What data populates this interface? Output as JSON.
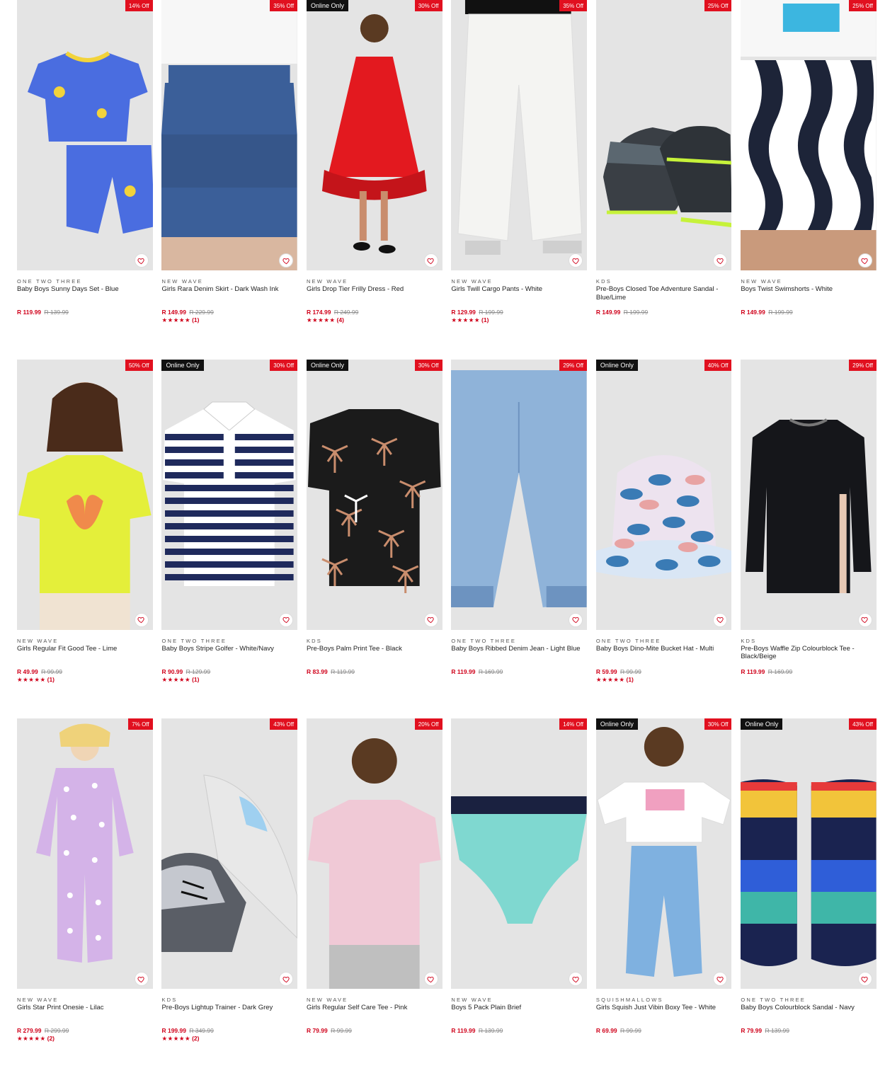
{
  "colors": {
    "sale_red": "#e1101f",
    "price_red": "#d0021b",
    "online_black": "#111111",
    "image_bg": "#e4e4e4"
  },
  "products": [
    {
      "brand": "ONE TWO THREE",
      "title": "Baby Boys Sunny Days Set - Blue",
      "price": "R 119.99",
      "was": "R 139.99",
      "discount": "14% Off",
      "online": "",
      "stars": "",
      "reviews": "",
      "art": "pajama",
      "colors": [
        "#4a6de0",
        "#f2d33b"
      ]
    },
    {
      "brand": "NEW WAVE",
      "title": "Girls Rara Denim Skirt - Dark Wash Ink",
      "price": "R 149.99",
      "was": "R 229.99",
      "discount": "35% Off",
      "online": "",
      "stars": "★★★★★",
      "reviews": "(1)",
      "art": "skirt",
      "colors": [
        "#3b5f99",
        "#ffffff"
      ]
    },
    {
      "brand": "NEW WAVE",
      "title": "Girls Drop Tier Frilly Dress - Red",
      "price": "R 174.99",
      "was": "R 249.99",
      "discount": "30% Off",
      "online": "Online Only",
      "stars": "★★★★★",
      "reviews": "(4)",
      "art": "dress",
      "colors": [
        "#e3191f",
        "#c98d6d"
      ]
    },
    {
      "brand": "NEW WAVE",
      "title": "Girls Twill Cargo Pants - White",
      "price": "R 129.99",
      "was": "R 199.99",
      "discount": "35% Off",
      "online": "",
      "stars": "★★★★★",
      "reviews": "(1)",
      "art": "pants",
      "colors": [
        "#f4f4f2",
        "#111111"
      ]
    },
    {
      "brand": "KDS",
      "title": "Pre-Boys Closed Toe Adventure Sandal - Blue/Lime",
      "price": "R 149.99",
      "was": "R 199.99",
      "discount": "25% Off",
      "online": "",
      "stars": "",
      "reviews": "",
      "art": "sandal",
      "colors": [
        "#5b6770",
        "#c6f23a"
      ]
    },
    {
      "brand": "NEW WAVE",
      "title": "Boys Twist Swimshorts - White",
      "price": "R 149.99",
      "was": "R 199.99",
      "discount": "25% Off",
      "online": "",
      "stars": "",
      "reviews": "",
      "art": "swim",
      "colors": [
        "#1d2438",
        "#ffffff"
      ]
    },
    {
      "brand": "NEW WAVE",
      "title": "Girls Regular Fit Good Tee - Lime",
      "price": "R 49.99",
      "was": "R 99.99",
      "discount": "50% Off",
      "online": "",
      "stars": "★★★★★",
      "reviews": "(1)",
      "art": "tee",
      "colors": [
        "#e4ef3a",
        "#f08a4b"
      ]
    },
    {
      "brand": "ONE TWO THREE",
      "title": "Baby Boys Stripe Golfer - White/Navy",
      "price": "R 90.99",
      "was": "R 129.99",
      "discount": "30% Off",
      "online": "Online Only",
      "stars": "★★★★★",
      "reviews": "(1)",
      "art": "golfer",
      "colors": [
        "#1f2a5c",
        "#ffffff"
      ]
    },
    {
      "brand": "KDS",
      "title": "Pre-Boys Palm Print Tee - Black",
      "price": "R 83.99",
      "was": "R 119.99",
      "discount": "30% Off",
      "online": "Online Only",
      "stars": "",
      "reviews": "",
      "art": "palmtee",
      "colors": [
        "#1b1b1b",
        "#c98d6d"
      ]
    },
    {
      "brand": "ONE TWO THREE",
      "title": "Baby Boys Ribbed Denim Jean - Light Blue",
      "price": "R 119.99",
      "was": "R 169.99",
      "discount": "29% Off",
      "online": "",
      "stars": "",
      "reviews": "",
      "art": "jean",
      "colors": [
        "#8fb3d9",
        "#6d93c0"
      ]
    },
    {
      "brand": "ONE TWO THREE",
      "title": "Baby Boys Dino-Mite Bucket Hat - Multi",
      "price": "R 59.99",
      "was": "R 99.99",
      "discount": "40% Off",
      "online": "Online Only",
      "stars": "★★★★★",
      "reviews": "(1)",
      "art": "hat",
      "colors": [
        "#ede3ef",
        "#3a7bb5"
      ]
    },
    {
      "brand": "KDS",
      "title": "Pre-Boys Waffle Zip Colourblock Tee - Black/Beige",
      "price": "R 119.99",
      "was": "R 169.99",
      "discount": "29% Off",
      "online": "",
      "stars": "",
      "reviews": "",
      "art": "longsleeve",
      "colors": [
        "#15161a",
        "#e8c9b4"
      ]
    },
    {
      "brand": "NEW WAVE",
      "title": "Girls Star Print Onesie - Lilac",
      "price": "R 279.99",
      "was": "R 299.99",
      "discount": "7% Off",
      "online": "",
      "stars": "★★★★★",
      "reviews": "(2)",
      "art": "onesie",
      "colors": [
        "#d4b3e8",
        "#ffffff"
      ]
    },
    {
      "brand": "KDS",
      "title": "Pre-Boys Lightup Trainer - Dark Grey",
      "price": "R 199.99",
      "was": "R 349.99",
      "discount": "43% Off",
      "online": "",
      "stars": "★★★★★",
      "reviews": "(2)",
      "art": "trainer",
      "colors": [
        "#5a5e66",
        "#9fd0f0"
      ]
    },
    {
      "brand": "NEW WAVE",
      "title": "Girls Regular Self Care Tee - Pink",
      "price": "R 79.99",
      "was": "R 99.99",
      "discount": "20% Off",
      "online": "",
      "stars": "",
      "reviews": "",
      "art": "pinktee",
      "colors": [
        "#f0c9d6",
        "#ffffff"
      ]
    },
    {
      "brand": "NEW WAVE",
      "title": "Boys 5 Pack Plain Brief",
      "price": "R 119.99",
      "was": "R 139.99",
      "discount": "14% Off",
      "online": "",
      "stars": "",
      "reviews": "",
      "art": "brief",
      "colors": [
        "#7fd8d0",
        "#1a2140"
      ]
    },
    {
      "brand": "SQUISHMALLOWS",
      "title": "Girls Squish Just Vibin Boxy Tee - White",
      "price": "R 69.99",
      "was": "R 99.99",
      "discount": "30% Off",
      "online": "Online Only",
      "stars": "",
      "reviews": "",
      "art": "boxytee",
      "colors": [
        "#ffffff",
        "#7fb1e0"
      ]
    },
    {
      "brand": "ONE TWO THREE",
      "title": "Baby Boys Colourblock Sandal - Navy",
      "price": "R 79.99",
      "was": "R 139.99",
      "discount": "43% Off",
      "online": "Online Only",
      "stars": "",
      "reviews": "",
      "art": "kidsandal",
      "colors": [
        "#1a2350",
        "#f2c43a"
      ]
    }
  ]
}
